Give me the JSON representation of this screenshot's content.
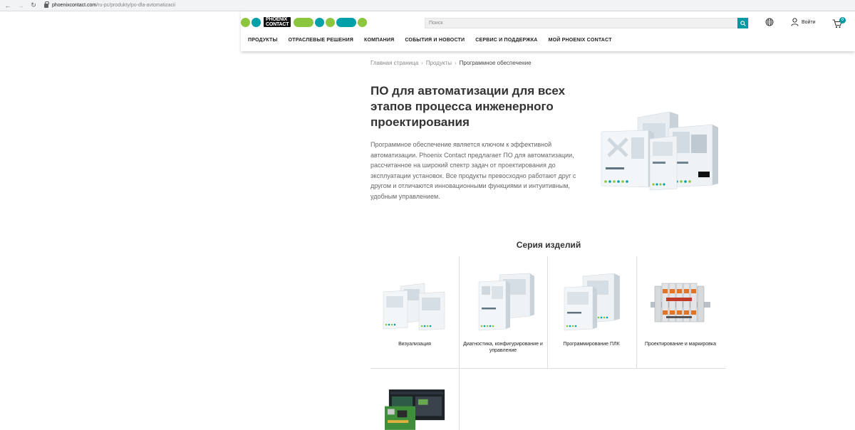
{
  "browser": {
    "domain": "phoenixcontact.com",
    "path": "/ru-pc/produkty/po-dla-avtomatizacii"
  },
  "header": {
    "brand_line1": "PHOENIX",
    "brand_line2": "CONTACT",
    "search_placeholder": "Поиск",
    "login_label": "Войти",
    "cart_count": "0",
    "nav": [
      "ПРОДУКТЫ",
      "ОТРАСЛЕВЫЕ РЕШЕНИЯ",
      "КОМПАНИЯ",
      "СОБЫТИЯ И НОВОСТИ",
      "СЕРВИС И ПОДДЕРЖКА",
      "МОЙ PHOENIX CONTACT"
    ]
  },
  "breadcrumb": {
    "items": [
      "Главная страница",
      "Продукты"
    ],
    "current": "Программное обеспечение"
  },
  "hero": {
    "title": "ПО для автоматизации для всех этапов процесса инженерного проектирования",
    "text": "Программное обеспечение является ключом к эффективной автоматизации. Phoenix Contact предлагает ПО для автоматизации, рассчитанное на широкий спектр задач от проектирования до эксплуатации установок. Все продукты превосходно работают друг с другом и отличаются инновационными функциями и интуитивным, удобным управлением."
  },
  "series": {
    "title": "Серия изделий",
    "items": [
      "Визуализация",
      "Диагностика, конфигурирование и управление",
      "Программирование ПЛК",
      "Проектирование и маркировка"
    ]
  },
  "colors": {
    "teal": "#0098a1",
    "green": "#8cc63f"
  }
}
